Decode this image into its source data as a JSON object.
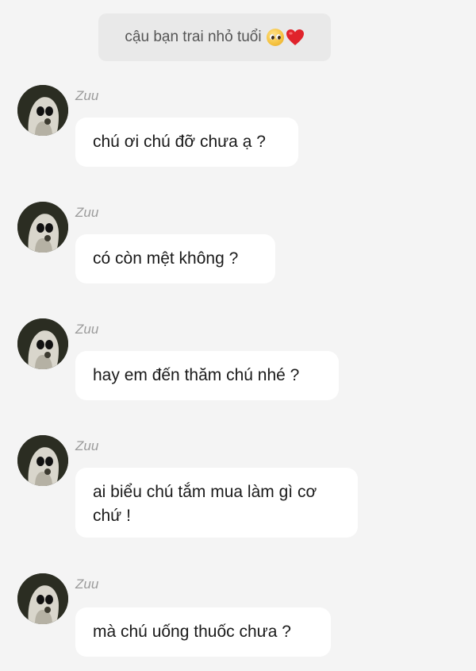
{
  "header": {
    "title": "cậu bạn trai nhỏ tuổi",
    "emojis": [
      "pleading-face-emoji",
      "red-heart-emoji"
    ]
  },
  "messages": [
    {
      "sender": "Zuu",
      "text": "chú ơi chú đỡ chưa ạ ?"
    },
    {
      "sender": "Zuu",
      "text": "có còn mệt không ?"
    },
    {
      "sender": "Zuu",
      "text": "hay em đến thăm chú nhé ?"
    },
    {
      "sender": "Zuu",
      "text": "ai biểu chú tắm mua làm gì cơ chứ !"
    },
    {
      "sender": "Zuu",
      "text": "mà chú uống thuốc chưa ?"
    }
  ],
  "colors": {
    "background": "#f4f4f4",
    "header_chip": "#e9e9e9",
    "bubble": "#ffffff",
    "sender_text": "#9b9b9b",
    "heart": "#e0232b"
  }
}
